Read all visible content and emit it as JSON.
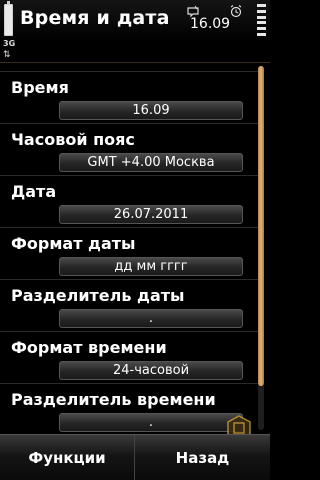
{
  "status_bar": {
    "title": "Время и дата",
    "clock": "16.09",
    "network_indicator": "3G",
    "network_arrows": "⇅",
    "icons": [
      "battery-icon",
      "notification-icon",
      "alarm-icon",
      "signal-icon"
    ]
  },
  "settings": [
    {
      "label": "Время",
      "value": "16.09"
    },
    {
      "label": "Часовой пояс",
      "value": "GMT +4.00  Москва"
    },
    {
      "label": "Дата",
      "value": "26.07.2011"
    },
    {
      "label": "Формат даты",
      "value": "дд мм гггг"
    },
    {
      "label": "Разделитель даты",
      "value": "."
    },
    {
      "label": "Формат времени",
      "value": "24-часовой"
    },
    {
      "label": "Разделитель времени",
      "value": "."
    }
  ],
  "softkeys": {
    "left": "Функции",
    "right": "Назад"
  },
  "colors": {
    "accent": "#d9a765",
    "background": "#000000"
  }
}
